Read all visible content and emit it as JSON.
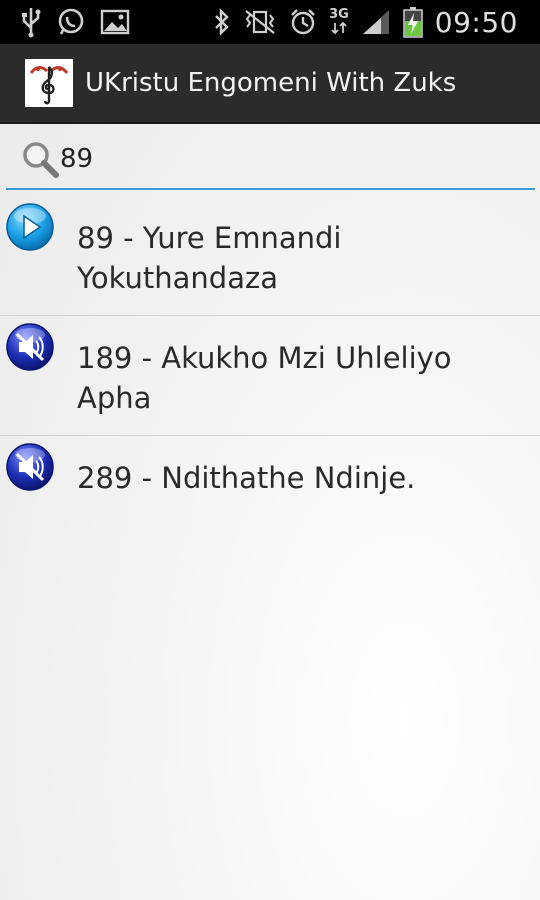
{
  "status_bar": {
    "time": "09:50",
    "network": "3G",
    "icons": [
      "usb-icon",
      "whatsapp-icon",
      "image-icon",
      "bluetooth-icon",
      "vibrate-icon",
      "alarm-icon",
      "network-3g-icon",
      "signal-icon",
      "battery-charging-icon"
    ]
  },
  "action_bar": {
    "title": "UKristu Engomeni With Zuks",
    "logo_icon": "treble-clef-logo-icon"
  },
  "search": {
    "value": "89",
    "icon": "search-icon"
  },
  "songs": [
    {
      "label": "89 - Yure Emnandi Yokuthandaza",
      "icon": "play-icon",
      "state": "playable"
    },
    {
      "label": "189 - Akukho Mzi Uhleliyo Apha",
      "icon": "muted-speaker-icon",
      "state": "unavailable"
    },
    {
      "label": "289 - Ndithathe Ndinje.",
      "icon": "muted-speaker-icon",
      "state": "unavailable"
    }
  ],
  "colors": {
    "accent": "#3a9bd5",
    "play_button": "#1aa0e8",
    "muted_button": "#1d2fb8",
    "action_bar": "#2b2b2b"
  }
}
